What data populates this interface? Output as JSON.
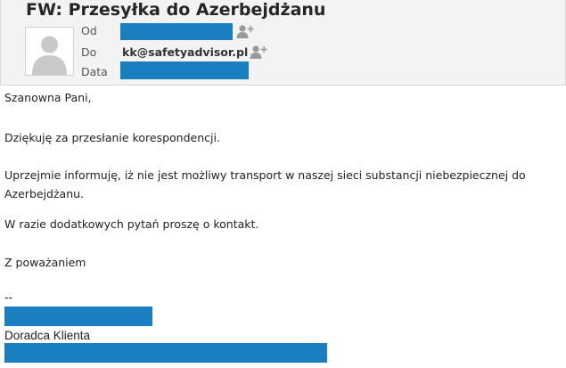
{
  "message": {
    "subject": "FW: Przesyłka do Azerbejdżanu",
    "from_label": "Od",
    "to_label": "Do",
    "to_value": "kk@safetyadvisor.pl",
    "date_label": "Data"
  },
  "body": {
    "greeting": "Szanowna Pani,",
    "paragraph1": "Dziękuję za przesłanie korespondencji.",
    "paragraph2_line1": "Uprzejmie informuję, iż nie jest możliwy transport w naszej sieci substancji niebezpiecznej do",
    "paragraph2_line2": "Azerbejdżanu.",
    "paragraph3": "W razie dodatkowych pytań proszę o kontakt.",
    "closing": "Z poważaniem"
  },
  "signature": {
    "separator": "--",
    "role": "Doradca Klienta"
  },
  "colors": {
    "redaction": "#1a7fc1",
    "header_bg": "#f3f3f3"
  },
  "icons": {
    "avatar": "person-silhouette-icon",
    "add_contact": "add-contact-icon"
  }
}
